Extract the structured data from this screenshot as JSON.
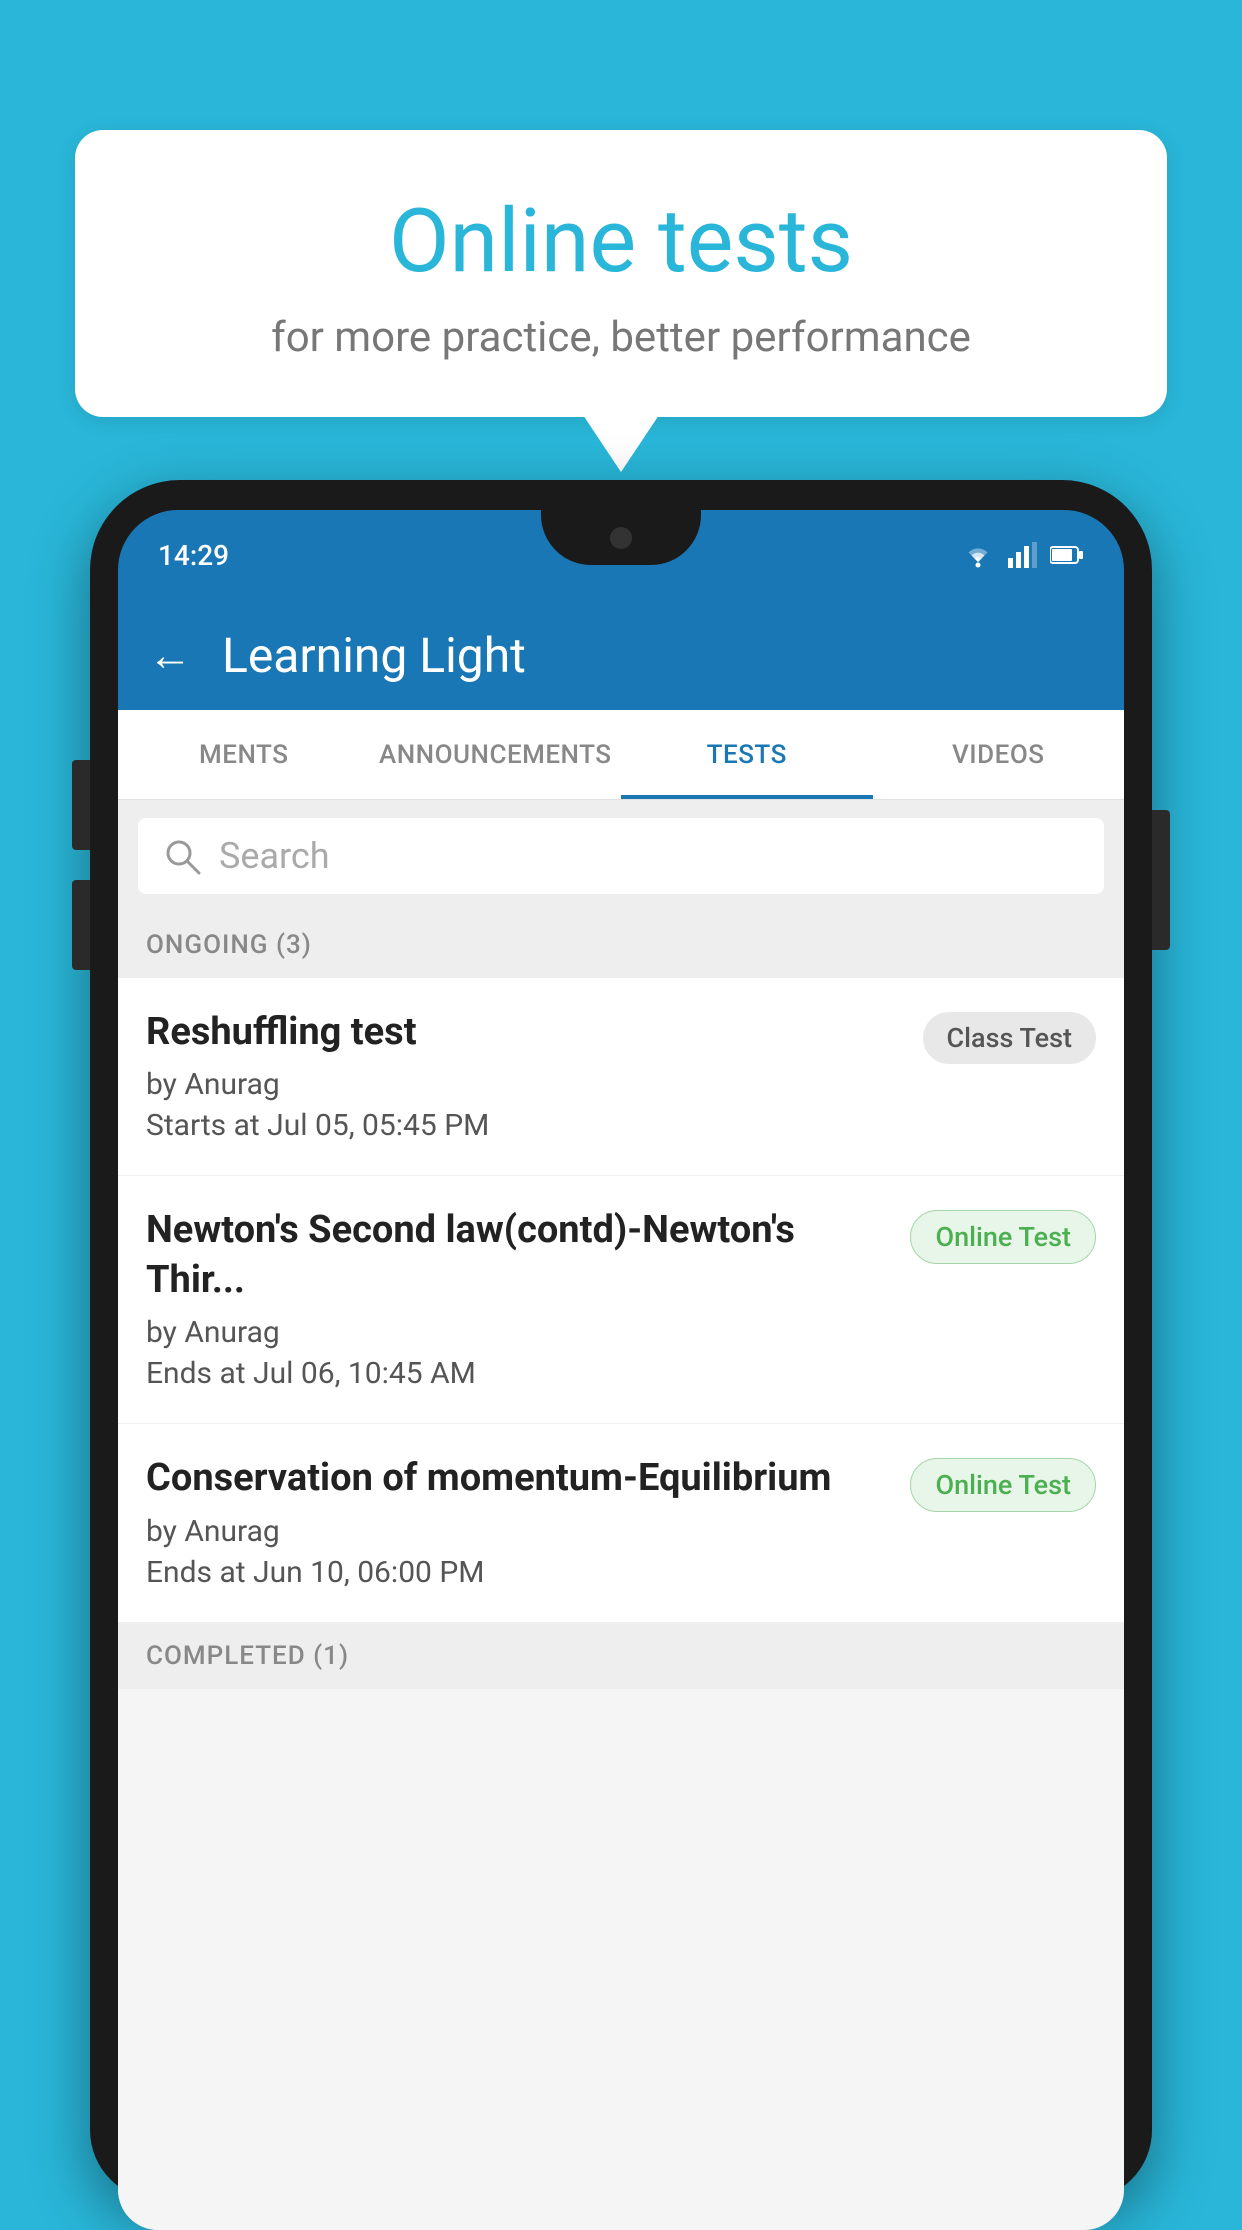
{
  "background": {
    "color": "#29b6d8"
  },
  "speech_bubble": {
    "title": "Online tests",
    "subtitle": "for more practice, better performance"
  },
  "phone": {
    "status_bar": {
      "time": "14:29",
      "icons": [
        "wifi",
        "signal",
        "battery"
      ]
    },
    "app_header": {
      "back_label": "←",
      "title": "Learning Light"
    },
    "tabs": [
      {
        "label": "MENTS",
        "active": false
      },
      {
        "label": "ANNOUNCEMENTS",
        "active": false
      },
      {
        "label": "TESTS",
        "active": true
      },
      {
        "label": "VIDEOS",
        "active": false
      }
    ],
    "search": {
      "placeholder": "Search",
      "icon": "search-icon"
    },
    "sections": [
      {
        "label": "ONGOING (3)",
        "items": [
          {
            "name": "Reshuffling test",
            "by": "by Anurag",
            "time": "Starts at  Jul 05, 05:45 PM",
            "badge": "Class Test",
            "badge_type": "class"
          },
          {
            "name": "Newton's Second law(contd)-Newton's Thir...",
            "by": "by Anurag",
            "time": "Ends at  Jul 06, 10:45 AM",
            "badge": "Online Test",
            "badge_type": "online"
          },
          {
            "name": "Conservation of momentum-Equilibrium",
            "by": "by Anurag",
            "time": "Ends at  Jun 10, 06:00 PM",
            "badge": "Online Test",
            "badge_type": "online"
          }
        ]
      },
      {
        "label": "COMPLETED (1)",
        "items": []
      }
    ]
  }
}
